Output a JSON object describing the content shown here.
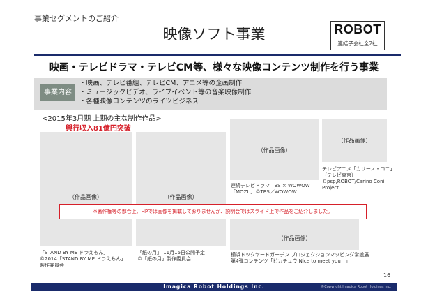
{
  "header": {
    "section_label": "事業セグメントのご紹介",
    "title": "映像ソフト事業"
  },
  "logo": {
    "text": "ROBOT",
    "subtitle": "連結子会社全2社"
  },
  "subtitle": "映画・テレビドラマ・テレビCM等、様々な映像コンテンツ制作を行う事業",
  "business": {
    "label": "事業内容",
    "items": [
      "・映画、テレビ番組、テレビCM、アニメ等の企画制作",
      "・ミュージックビデオ、ライブイベント等の音楽映像制作",
      "・各種映像コンテンツのライツビジネス"
    ]
  },
  "works": {
    "period_label": "<2015年3月期 上期の主な制作作品>",
    "revenue_label": "興行収入81億円突破",
    "cards": [
      {
        "placeholder": "（作品画像）",
        "caption": [
          "「STAND BY ME ドラえもん」",
          "©2014「STAND BY ME ドラえもん」",
          "製作委員会"
        ]
      },
      {
        "placeholder": "（作品画像）",
        "caption": [
          "「紙の月」 11月15日公開予定",
          "©「紙の月」製作委員会"
        ]
      },
      {
        "placeholder": "（作品画像）",
        "caption": [
          "連続テレビドラマ TBS × WOWOW",
          "「MOZU」©TBS／WOWOW"
        ]
      },
      {
        "placeholder": "（作品画像）",
        "caption": [
          "テレビアニメ「カリーノ・コニ」",
          "（テレビ東京）",
          "©psp,ROBOT/Carino Coni",
          "Project"
        ]
      },
      {
        "placeholder": "（作品画像）",
        "caption": [
          "横浜ドックヤードガーデン プロジェクションマッピング常設展",
          "第4弾コンテンツ「ピカチュウ Nice to meet you！」"
        ]
      }
    ]
  },
  "notice": "※著作権等の都合上、HPでは画像を掲載しておりませんが、説明会ではスライド上で作品をご紹介しました。",
  "page_number": "16",
  "footer": {
    "company": "Imagica Robot Holdings Inc.",
    "copyright": "©Copyright Imagica Robot Holdings Inc."
  },
  "colors": {
    "navy": "#1a2b6b",
    "accent_red": "#d6202a",
    "label_green_gray": "#7e8c83",
    "panel_gray": "#dcdcdc",
    "card_gray": "#e6e6e6"
  }
}
